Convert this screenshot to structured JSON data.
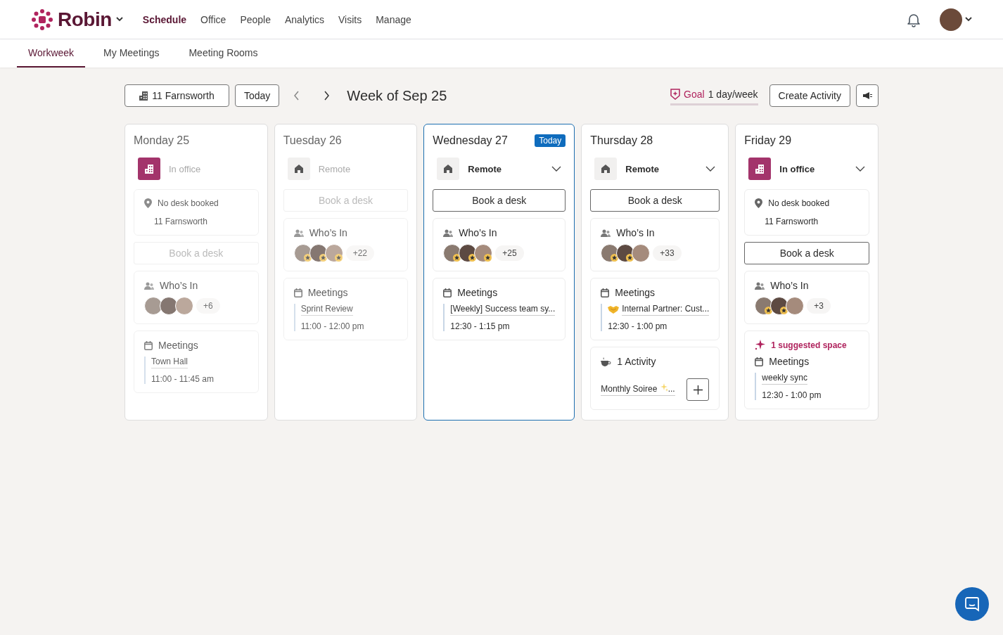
{
  "brand": {
    "name": "Robin"
  },
  "nav": [
    {
      "label": "Schedule",
      "selected": true
    },
    {
      "label": "Office",
      "selected": false
    },
    {
      "label": "People",
      "selected": false
    },
    {
      "label": "Analytics",
      "selected": false
    },
    {
      "label": "Visits",
      "selected": false
    },
    {
      "label": "Manage",
      "selected": false
    }
  ],
  "tabs": [
    {
      "label": "Workweek",
      "selected": true
    },
    {
      "label": "My Meetings",
      "selected": false
    },
    {
      "label": "Meeting Rooms",
      "selected": false
    }
  ],
  "toolbar": {
    "location": "11 Farnsworth",
    "today": "Today",
    "week": "Week of Sep 25",
    "goal_label": "Goal",
    "goal_value": "1 day/week",
    "create": "Create Activity"
  },
  "days": [
    {
      "name": "Monday 25",
      "today": false,
      "past": true,
      "status": {
        "kind": "office",
        "label": "In office"
      },
      "desk": {
        "label": "No desk booked",
        "location": "11 Farnsworth"
      },
      "book": "Book a desk",
      "whos_in": {
        "title": "Who’s In",
        "avatars": [
          {
            "starred": false
          },
          {
            "starred": false
          },
          {
            "starred": false
          }
        ],
        "more": "+6"
      },
      "meetings": {
        "title": "Meetings",
        "items": [
          {
            "title": "Town Hall",
            "time": "11:00 - 11:45 am",
            "icon": false
          }
        ]
      }
    },
    {
      "name": "Tuesday 26",
      "today": false,
      "past": true,
      "status": {
        "kind": "remote",
        "label": "Remote"
      },
      "book": "Book a desk",
      "whos_in": {
        "title": "Who’s In",
        "avatars": [
          {
            "starred": true
          },
          {
            "starred": true
          },
          {
            "starred": true
          }
        ],
        "more": "+22"
      },
      "meetings": {
        "title": "Meetings",
        "items": [
          {
            "title": "Sprint Review",
            "time": "11:00 - 12:00 pm",
            "icon": false
          }
        ]
      }
    },
    {
      "name": "Wednesday 27",
      "today": true,
      "today_label": "Today",
      "past": false,
      "status": {
        "kind": "remote",
        "label": "Remote"
      },
      "book": "Book a desk",
      "whos_in": {
        "title": "Who’s In",
        "avatars": [
          {
            "starred": true
          },
          {
            "starred": true
          },
          {
            "starred": true
          }
        ],
        "more": "+25"
      },
      "meetings": {
        "title": "Meetings",
        "items": [
          {
            "title": "[Weekly] Success team sy...",
            "time": "12:30 - 1:15 pm",
            "icon": false
          }
        ]
      }
    },
    {
      "name": "Thursday 28",
      "today": false,
      "past": false,
      "status": {
        "kind": "remote",
        "label": "Remote"
      },
      "book": "Book a desk",
      "whos_in": {
        "title": "Who’s In",
        "avatars": [
          {
            "starred": true
          },
          {
            "starred": true
          },
          {
            "starred": false
          }
        ],
        "more": "+33"
      },
      "meetings": {
        "title": "Meetings",
        "items": [
          {
            "title": "Internal Partner: Cust...",
            "time": "12:30 - 1:00 pm",
            "icon": true
          }
        ]
      },
      "activity": {
        "title": "1 Activity",
        "item": "Monthly Soiree",
        "item_tail": "..."
      }
    },
    {
      "name": "Friday 29",
      "today": false,
      "past": false,
      "status": {
        "kind": "office",
        "label": "In office"
      },
      "desk": {
        "label": "No desk booked",
        "location": "11 Farnsworth"
      },
      "book": "Book a desk",
      "whos_in": {
        "title": "Who’s In",
        "avatars": [
          {
            "starred": true
          },
          {
            "starred": true
          },
          {
            "starred": false
          }
        ],
        "more": "+3"
      },
      "suggested": "1 suggested space",
      "meetings": {
        "title": "Meetings",
        "items": [
          {
            "title": "weekly sync",
            "time": "12:30 - 1:00 pm",
            "icon": false
          }
        ]
      }
    }
  ]
}
